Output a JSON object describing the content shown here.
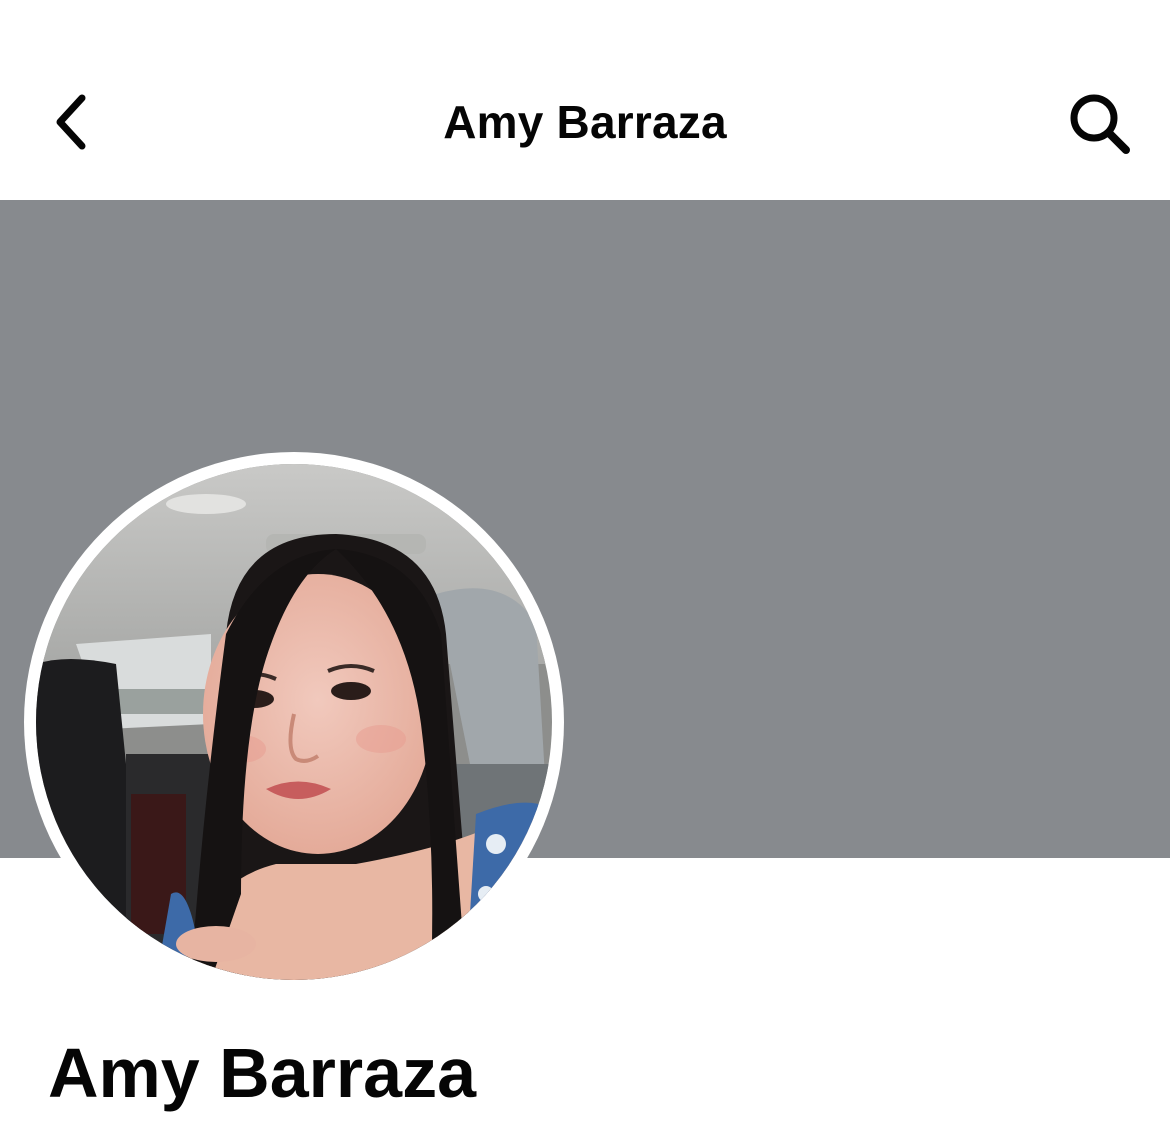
{
  "header": {
    "title": "Amy Barraza",
    "back_icon": "chevron-left-icon",
    "search_icon": "search-icon"
  },
  "cover": {
    "color": "#878a8e"
  },
  "profile": {
    "name": "Amy Barraza",
    "avatar": "profile-photo"
  }
}
